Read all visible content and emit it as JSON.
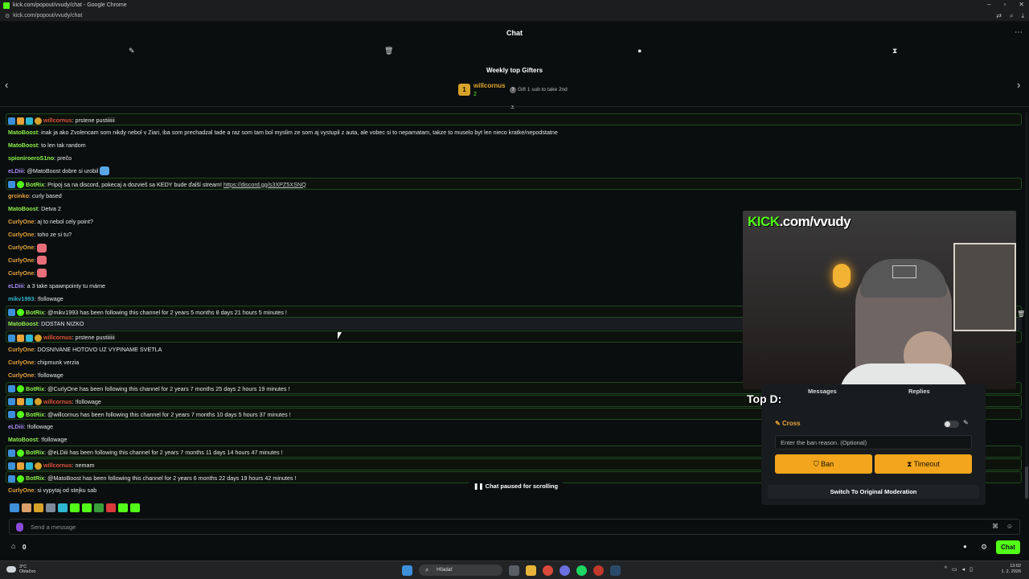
{
  "browser": {
    "window_title": "kick.com/popout/vvudy/chat - Google Chrome",
    "url": "kick.com/popout/vvudy/chat"
  },
  "header": {
    "title": "Chat"
  },
  "gifters": {
    "title": "Weekly top Gifters",
    "rank": "1",
    "name": "willcornus",
    "count": "2",
    "hint": "Gift 1 sub to take 2nd"
  },
  "messages": [
    {
      "user": "willcornus",
      "color": "#e0523a",
      "badges": [
        "blue",
        "orange",
        "cyan",
        "gold"
      ],
      "text": ": prstene pustiiiiii",
      "style": "boxed"
    },
    {
      "user": "MatoBoost",
      "color": "#8bf04a",
      "badges": [],
      "text": ": inak ja ako Zvolencam som nikdy nebol v Ziari, iba som prechadzal tade a raz som tam bol myslim ze som aj vystupil z auta, ale vobec si to nepamatam, takze to muselo byt len nieco kratke/nepodstatne",
      "style": "plain"
    },
    {
      "user": "MatoBoost",
      "color": "#8bf04a",
      "badges": [],
      "text": ": to len tak random",
      "style": "plain"
    },
    {
      "user": "spioniroeroS1no",
      "color": "#8bf04a",
      "badges": [],
      "text": ": prečo",
      "style": "plain"
    },
    {
      "user": "eLDiii",
      "color": "#a98bf5",
      "badges": [],
      "text": ": @MatoBoost dobre si urobil",
      "style": "plain",
      "emote": "#5aa7e8"
    },
    {
      "user": "BotRix",
      "color": "#8bf04a",
      "badges": [
        "blue",
        "check"
      ],
      "text": ": Pripoj sa na discord, pokecaj a dozvieš sa KEDY bude ďalší stream! ",
      "link": "https://discord.gg/s3XPZ5XSNQ",
      "style": "boxed"
    },
    {
      "user": "grcinko",
      "color": "#e8a33a",
      "badges": [],
      "text": ": curly based",
      "style": "plain"
    },
    {
      "user": "MatoBoost",
      "color": "#8bf04a",
      "badges": [],
      "text": ": Detva 2",
      "style": "plain"
    },
    {
      "user": "CurlyOne",
      "color": "#e8a33a",
      "badges": [],
      "text": ": aj to nebol cely point?",
      "style": "plain"
    },
    {
      "user": "CurlyOne",
      "color": "#e8a33a",
      "badges": [],
      "text": ": toho ze si tu?",
      "style": "plain"
    },
    {
      "user": "CurlyOne",
      "color": "#e8a33a",
      "badges": [],
      "text": ":",
      "style": "plain",
      "emote": "#e86f7a"
    },
    {
      "user": "CurlyOne",
      "color": "#e8a33a",
      "badges": [],
      "text": ":",
      "style": "plain",
      "emote": "#e86f7a"
    },
    {
      "user": "CurlyOne",
      "color": "#e8a33a",
      "badges": [],
      "text": ":",
      "style": "plain",
      "emote": "#e86f7a"
    },
    {
      "user": "eLDiii",
      "color": "#a98bf5",
      "badges": [],
      "text": ": a 3 take spawnpointy tu máme",
      "style": "plain"
    },
    {
      "user": "mikv1993",
      "color": "#2fb6d0",
      "badges": [],
      "text": ": !followage",
      "style": "plain"
    },
    {
      "user": "BotRix",
      "color": "#8bf04a",
      "badges": [
        "blue",
        "check"
      ],
      "text": ": @mikv1993 has been following this channel for 2 years 5 months 8 days 21 hours 5 minutes !",
      "style": "boxed"
    },
    {
      "user": "MatoBoost",
      "color": "#8bf04a",
      "badges": [],
      "text": ": DOSTAN NIZKO",
      "style": "hl"
    },
    {
      "user": "willcornus",
      "color": "#e0523a",
      "badges": [
        "blue",
        "orange",
        "cyan",
        "gold"
      ],
      "text": ": prstene pustiiiiii",
      "style": "boxed"
    },
    {
      "user": "CurlyOne",
      "color": "#e8a33a",
      "badges": [],
      "text": ": DOSNIVANE HOTOVO UZ VYPINAME SVETLA",
      "style": "plain"
    },
    {
      "user": "CurlyOne",
      "color": "#e8a33a",
      "badges": [],
      "text": ": chipmunk verzia",
      "style": "plain"
    },
    {
      "user": "CurlyOne",
      "color": "#e8a33a",
      "badges": [],
      "text": ": !followage",
      "style": "plain"
    },
    {
      "user": "BotRix",
      "color": "#8bf04a",
      "badges": [
        "blue",
        "check"
      ],
      "text": ": @CurlyOne has been following this channel for 2 years 7 months 25 days 2 hours 19 minutes !",
      "style": "boxed"
    },
    {
      "user": "willcornus",
      "color": "#e0523a",
      "badges": [
        "blue",
        "orange",
        "cyan",
        "gold"
      ],
      "text": ": !followage",
      "style": "boxed"
    },
    {
      "user": "BotRix",
      "color": "#8bf04a",
      "badges": [
        "blue",
        "check"
      ],
      "text": ": @willcornus has been following this channel for 2 years 7 months 10 days 5 hours 37 minutes !",
      "style": "boxed"
    },
    {
      "user": "eLDiii",
      "color": "#a98bf5",
      "badges": [],
      "text": ": !followage",
      "style": "plain"
    },
    {
      "user": "MatoBoost",
      "color": "#8bf04a",
      "badges": [],
      "text": ": !followage",
      "style": "plain"
    },
    {
      "user": "BotRix",
      "color": "#8bf04a",
      "badges": [
        "blue",
        "check"
      ],
      "text": ": @eLDiii has been following this channel for 2 years 7 months 11 days 14 hours 47 minutes !",
      "style": "boxed"
    },
    {
      "user": "willcornus",
      "color": "#e0523a",
      "badges": [
        "blue",
        "orange",
        "cyan",
        "gold"
      ],
      "text": ": nemam",
      "style": "boxed"
    },
    {
      "user": "BotRix",
      "color": "#8bf04a",
      "badges": [
        "blue",
        "check"
      ],
      "text": ": @MatoBoost has been following this channel for 2 years 6 months 22 days 19 hours 42 minutes !",
      "style": "boxed"
    },
    {
      "user": "CurlyOne",
      "color": "#e8a33a",
      "badges": [],
      "text": ": si vypytaj od stejku sab",
      "style": "plain"
    }
  ],
  "paused_label": "Chat paused for scrolling",
  "emote_bar_colors": [
    "#3d8fd9",
    "#d9a06a",
    "#d7a22a",
    "#7d8a9a",
    "#2fb6d0",
    "#53fc18",
    "#53fc18",
    "#3a9e3a",
    "#d93a3a",
    "#53fc18",
    "#53fc18"
  ],
  "input": {
    "placeholder": "Send a message"
  },
  "footer": {
    "count": "0",
    "chat_button": "Chat"
  },
  "stream": {
    "brand_green": "KICK",
    "brand_white": ".com/vvudy"
  },
  "moderation": {
    "overlay_text": "Top D:",
    "tab_messages": "Messages",
    "tab_replies": "Replies",
    "user": "Cross",
    "reason_placeholder": "Enter the ban reason. (Optional)",
    "ban_label": "Ban",
    "timeout_label": "Timeout",
    "switch_label": "Switch To Original Moderation"
  },
  "taskbar": {
    "weather_temp": "3°C",
    "weather_text": "Oblačno",
    "search_label": "Hľadať",
    "time": "13:02",
    "date": "1. 2. 2026"
  },
  "colors": {
    "accent": "#53fc18",
    "moderation_button": "#f2a51d"
  }
}
